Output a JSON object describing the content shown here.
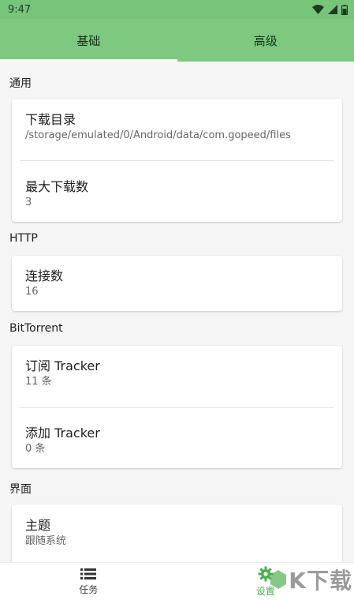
{
  "status_bar": {
    "time": "9:47"
  },
  "tabs": [
    {
      "label": "基础",
      "active": true
    },
    {
      "label": "高级",
      "active": false
    }
  ],
  "sections": {
    "general": {
      "title": "通用",
      "items": [
        {
          "title": "下载目录",
          "value": "/storage/emulated/0/Android/data/com.gopeed/files"
        },
        {
          "title": "最大下载数",
          "value": "3"
        }
      ]
    },
    "http": {
      "title": "HTTP",
      "items": [
        {
          "title": "连接数",
          "value": "16"
        }
      ]
    },
    "bittorrent": {
      "title": "BitTorrent",
      "items": [
        {
          "title": "订阅 Tracker",
          "value": "11 条"
        },
        {
          "title": "添加 Tracker",
          "value": "0 条"
        }
      ]
    },
    "ui": {
      "title": "界面",
      "items": [
        {
          "title": "主题",
          "value": "跟随系统"
        }
      ]
    }
  },
  "bottom_nav": [
    {
      "label": "任务",
      "icon": "list-icon",
      "active": false
    },
    {
      "label": "设置",
      "icon": "gear-icon",
      "active": true
    }
  ],
  "watermark": {
    "text": "K下载"
  },
  "colors": {
    "header": "#7cc97f",
    "accent": "#4caf50"
  }
}
